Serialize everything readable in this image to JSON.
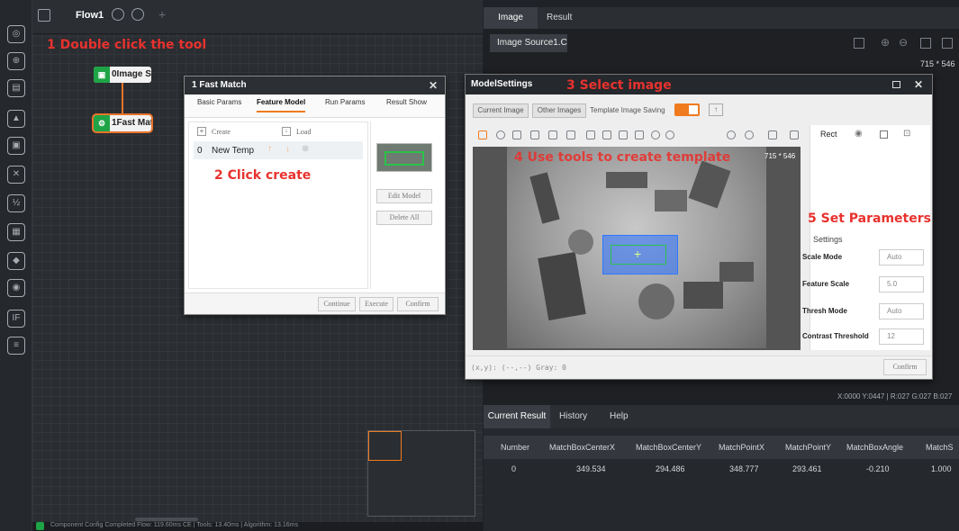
{
  "flow": {
    "tab_label": "Flow1"
  },
  "annotations": {
    "step1": "1 Double click the tool",
    "step2": "2 Click create",
    "step3": "3 Select image",
    "step4": "4 Use tools to create template",
    "step5": "5 Set Parameters"
  },
  "nodes": [
    {
      "label": "0Image S...",
      "icon": "image-icon"
    },
    {
      "label": "1Fast Mat...",
      "icon": "fast-match-icon"
    }
  ],
  "fast_match": {
    "title": "1 Fast Match",
    "tabs": [
      "Basic Params",
      "Feature Model",
      "Run Params",
      "Result Show"
    ],
    "active_tab": "Feature Model",
    "create_label": "Create",
    "load_label": "Load",
    "template_index": "0",
    "template_name": "New Temp",
    "edit_model": "Edit Model",
    "delete_all": "Delete All",
    "continue": "Continue",
    "execute": "Execute",
    "confirm": "Confirm"
  },
  "model_settings": {
    "title": "ModelSettings",
    "current_image": "Current Image",
    "other_images": "Other Images",
    "template_image_saving": "Template Image Saving",
    "image_size": "715 * 546",
    "rect_label": "Rect",
    "settings_label": "Settings",
    "params": [
      {
        "label": "Scale Mode",
        "value": "Auto"
      },
      {
        "label": "Feature Scale",
        "value": "5.0"
      },
      {
        "label": "Thresh Mode",
        "value": "Auto"
      },
      {
        "label": "Contrast Threshold",
        "value": "12"
      }
    ],
    "status": "(x,y): (--,--) Gray: 0",
    "confirm": "Confirm"
  },
  "right_pane": {
    "tabs": [
      "Image",
      "Result"
    ],
    "source": "Image Source1.C",
    "image_size": "715 * 546",
    "coords": "X:0000  Y:0447  |  R:027  G:027  B:027",
    "result_tabs": [
      "Current Result",
      "History",
      "Help"
    ],
    "columns": [
      "Number",
      "MatchBoxCenterX",
      "MatchBoxCenterY",
      "MatchPointX",
      "MatchPointY",
      "MatchBoxAngle",
      "MatchS"
    ],
    "rows": [
      [
        "0",
        "349.534",
        "294.486",
        "348.777",
        "293.461",
        "-0.210",
        "1.000"
      ]
    ]
  },
  "status_bar": {
    "text": "Component Config Completed  Flow: 119.60ms  CE  |  Tools: 13.40ms  |  Algorithm: 13.16ms"
  },
  "colors": {
    "accent_orange": "#f07a1e",
    "annotation_red": "#e8322e",
    "node_green": "#1ea446"
  }
}
